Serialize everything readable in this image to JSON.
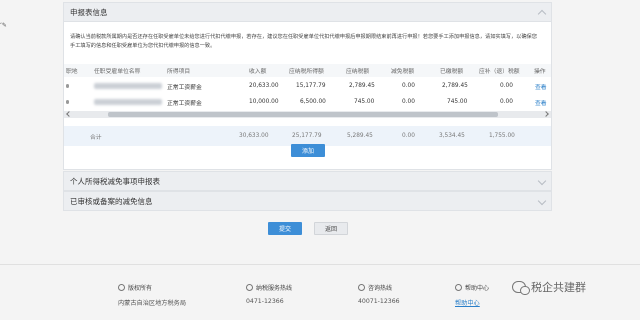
{
  "left_edge": {
    "text": "‘",
    "pin_glyph": "✎"
  },
  "sections": {
    "declare": {
      "title": "申报表信息"
    },
    "deduction": {
      "title": "个人所得税减免事项申报表"
    },
    "approved": {
      "title": "已审核或备案的减免信息"
    }
  },
  "notice": "请确认当前税款所属期内是否还存在任职受雇单位未给您进行代扣代缴申报，若存在，建议您在任职受雇单位代扣代缴申报后申报期限结束前再进行申报！若您要手工添加申报信息，请如实填写，以确保您手工填写的信息和任职受雇单位为您代扣代缴申报的信息一致。",
  "table": {
    "headers": [
      "职地",
      "任职受雇单位名称",
      "所得项目",
      "收入额",
      "应纳税所得额",
      "应纳税额",
      "减免税额",
      "已缴税额",
      "应补（退）税额",
      "操作"
    ],
    "rows": [
      {
        "item": "正常工资薪金",
        "income": "20,633.00",
        "taxable": "15,177.79",
        "tax": "2,789.45",
        "relief": "0.00",
        "paid": "2,789.45",
        "due": "0.00",
        "action": "查看"
      },
      {
        "item": "正常工资薪金",
        "income": "10,000.00",
        "taxable": "6,500.00",
        "tax": "745.00",
        "relief": "0.00",
        "paid": "745.00",
        "due": "0.00",
        "action": "查看"
      }
    ],
    "total": {
      "label": "合计",
      "income": "30,633.00",
      "taxable": "25,177.79",
      "tax": "5,289.45",
      "relief": "0.00",
      "paid": "3,534.45",
      "due": "1,755.00"
    }
  },
  "buttons": {
    "add": "添加",
    "submit": "提交",
    "back": "返回"
  },
  "footer": {
    "copyright": {
      "title": "版权所有",
      "value": "内蒙古自治区地方税务局"
    },
    "hotline": {
      "title": "纳税服务热线",
      "value": "0471-12366"
    },
    "consult": {
      "title": "咨询热线",
      "value": "40071-12366"
    },
    "help": {
      "title": "帮助中心",
      "value": "帮助中心"
    }
  },
  "watermark": "税企共建群",
  "colors": {
    "accent": "#3d8ed7",
    "link": "#2a7fc9",
    "header_bg": "#eceef1"
  }
}
